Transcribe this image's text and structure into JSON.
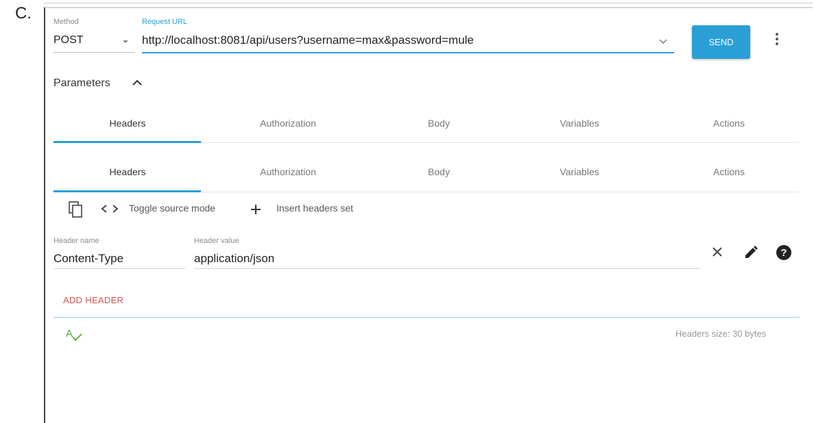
{
  "option_letter": "C.",
  "request": {
    "method_label": "Method",
    "method_value": "POST",
    "url_label": "Request URL",
    "url_value": "http://localhost:8081/api/users?username=max&password=mule",
    "send_label": "SEND"
  },
  "parameters_label": "Parameters",
  "tabs_primary": [
    "Headers",
    "Authorization",
    "Body",
    "Variables",
    "Actions"
  ],
  "tabs_secondary": [
    "Headers",
    "Authorization",
    "Body",
    "Variables",
    "Actions"
  ],
  "toolbar": {
    "toggle_source_label": "Toggle source mode",
    "insert_headers_label": "Insert headers set"
  },
  "header_row": {
    "name_label": "Header name",
    "name_value": "Content-Type",
    "value_label": "Header value",
    "value_value": "application/json"
  },
  "add_header_label": "ADD HEADER",
  "headers_size_text": "Headers size: 30 bytes",
  "colors": {
    "accent": "#2a9fd6",
    "add_header": "#d9534f",
    "autocomplete_icon": "#5aa63a"
  },
  "icons": [
    "dropdown-arrow-icon",
    "chevron-down-icon",
    "more-vert-icon",
    "chevron-up-icon",
    "copy-icon",
    "code-icon",
    "plus-icon",
    "close-icon",
    "edit-icon",
    "help-icon",
    "spellcheck-icon"
  ]
}
